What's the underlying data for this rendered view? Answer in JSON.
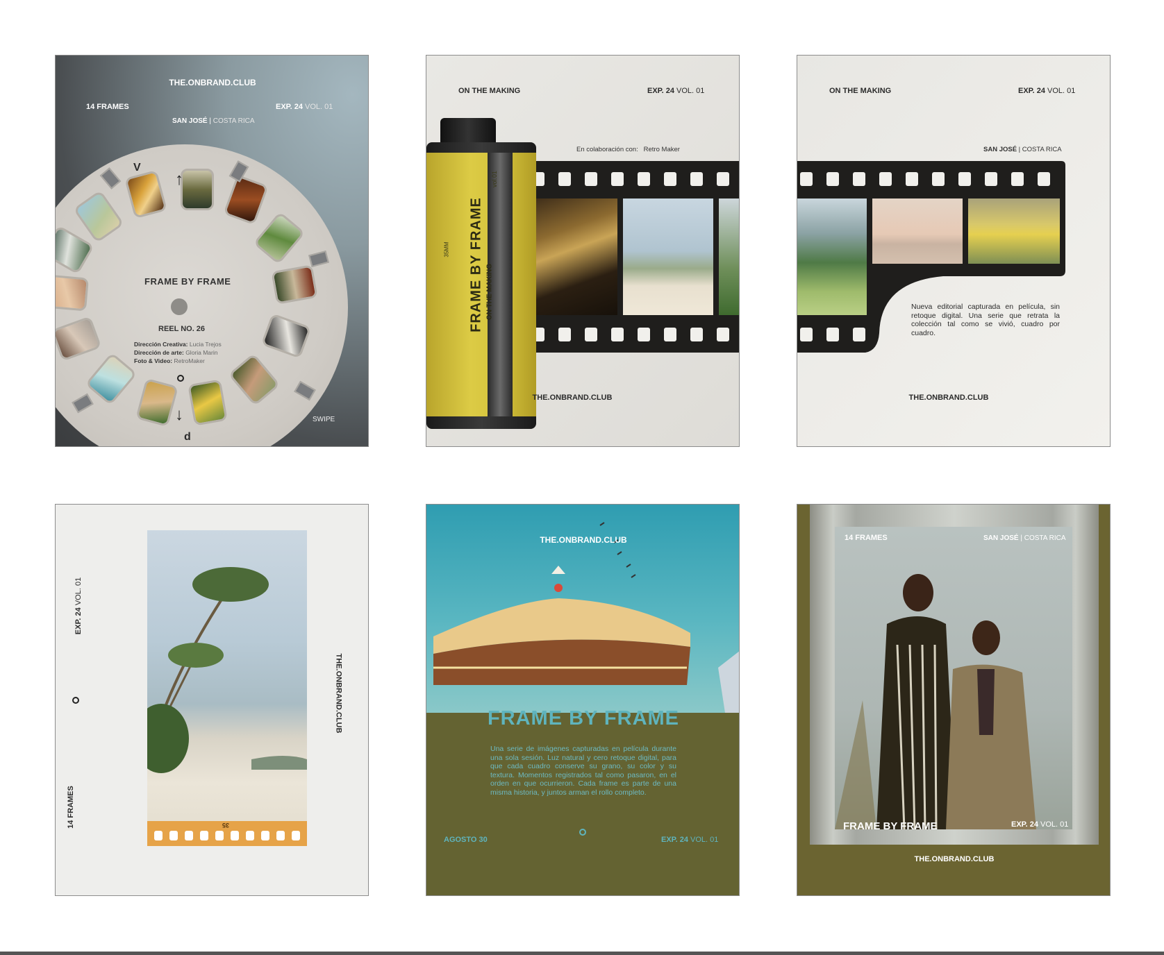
{
  "cards": {
    "c1": {
      "brand": "THE.ONBRAND.CLUB",
      "frames": "14 FRAMES",
      "exp": "EXP. 24",
      "vol": "VOL. 01",
      "city": "SAN JOSÉ",
      "country": "COSTA RICA",
      "title": "FRAME BY FRAME",
      "reel": "REEL NO. 26",
      "credit1_label": "Dirección Creativa:",
      "credit1_value": "Lucia Trejos",
      "credit2_label": "Dirección de arte:",
      "credit2_value": "Gloria Marin",
      "credit3_label": "Foto & Video:",
      "credit3_value": "RetroMaker",
      "swipe": "SWIPE",
      "v": "V",
      "d": "d"
    },
    "c2": {
      "making": "ON THE MAKING",
      "exp": "EXP. 24",
      "vol": "VOL. 01",
      "collab_label": "En colaboración con:",
      "collab_value": "Retro Maker",
      "can_title": "FRAME BY FRAME",
      "can_sub": "ON THE MAKING",
      "can_vol": "vol.01",
      "can_mm": "35MM",
      "brand": "THE.ONBRAND.CLUB"
    },
    "c3": {
      "making": "ON THE MAKING",
      "exp": "EXP. 24",
      "vol": "VOL. 01",
      "city": "SAN JOSÉ",
      "country": "COSTA RICA",
      "body": "Nueva editorial capturada en película, sin retoque digital. Una serie que retrata la colección tal como se vivió, cuadro por cuadro.",
      "brand": "THE.ONBRAND.CLUB"
    },
    "c4": {
      "exp": "EXP. 24",
      "vol": "VOL. 01",
      "frames": "14 FRAMES",
      "brand": "THE.ONBRAND.CLUB",
      "edge_code": "35"
    },
    "c5": {
      "brand": "THE.ONBRAND.CLUB",
      "title": "FRAME BY FRAME",
      "body": "Una serie de imágenes capturadas en película durante una sola sesión. Luz natural y cero retoque digital, para que cada cuadro conserve su grano, su color y su textura. Momentos registrados tal como pasaron, en el orden en que ocurrieron. Cada frame es parte de una misma historia, y juntos arman el rollo completo.",
      "date": "AGOSTO 30",
      "exp": "EXP. 24",
      "vol": "VOL. 01"
    },
    "c6": {
      "frames": "14 FRAMES",
      "city": "SAN JOSÉ",
      "country": "COSTA RICA",
      "title": "FRAME BY FRAME",
      "exp": "EXP. 24",
      "vol": "VOL. 01",
      "brand": "THE.ONBRAND.CLUB"
    }
  },
  "colors": {
    "card5_olive": "#646332",
    "card5_teal_text": "#5fb4bd",
    "canister_yellow": "#d8c53b",
    "film_black": "#1f1e1c",
    "card6_olive": "#6b6431"
  }
}
